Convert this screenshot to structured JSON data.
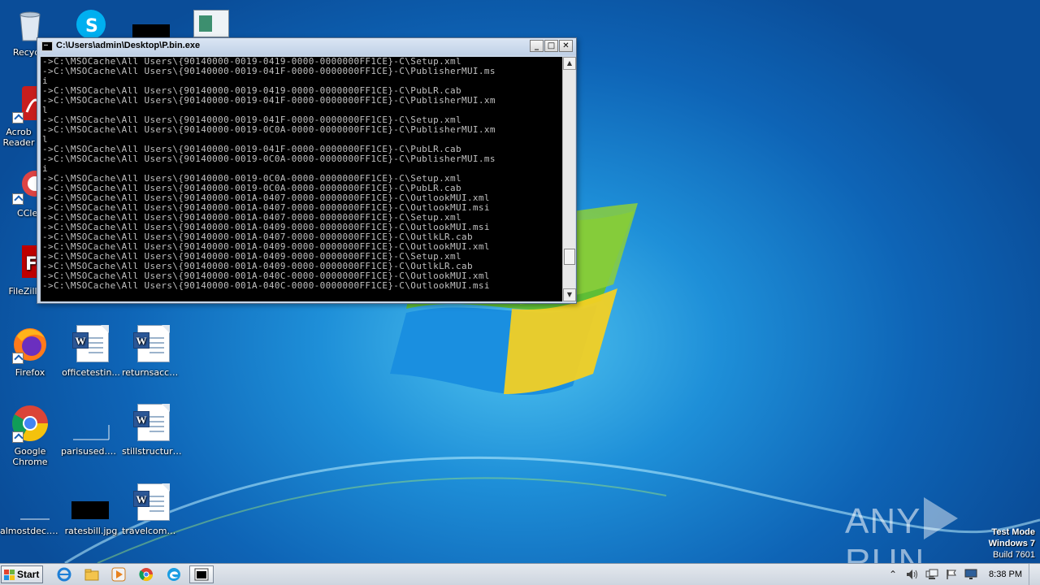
{
  "window": {
    "title": "C:\\Users\\admin\\Desktop\\P.bin.exe",
    "buttons": {
      "minimize": "_",
      "maximize": "□",
      "close": "✕"
    },
    "console_lines": [
      "->C:\\MSOCache\\All Users\\{90140000-0019-0419-0000-0000000FF1CE}-C\\Setup.xml",
      "->C:\\MSOCache\\All Users\\{90140000-0019-041F-0000-0000000FF1CE}-C\\PublisherMUI.ms",
      "i",
      "->C:\\MSOCache\\All Users\\{90140000-0019-0419-0000-0000000FF1CE}-C\\PubLR.cab",
      "->C:\\MSOCache\\All Users\\{90140000-0019-041F-0000-0000000FF1CE}-C\\PublisherMUI.xm",
      "l",
      "->C:\\MSOCache\\All Users\\{90140000-0019-041F-0000-0000000FF1CE}-C\\Setup.xml",
      "->C:\\MSOCache\\All Users\\{90140000-0019-0C0A-0000-0000000FF1CE}-C\\PublisherMUI.xm",
      "l",
      "->C:\\MSOCache\\All Users\\{90140000-0019-041F-0000-0000000FF1CE}-C\\PubLR.cab",
      "->C:\\MSOCache\\All Users\\{90140000-0019-0C0A-0000-0000000FF1CE}-C\\PublisherMUI.ms",
      "i",
      "->C:\\MSOCache\\All Users\\{90140000-0019-0C0A-0000-0000000FF1CE}-C\\Setup.xml",
      "->C:\\MSOCache\\All Users\\{90140000-0019-0C0A-0000-0000000FF1CE}-C\\PubLR.cab",
      "->C:\\MSOCache\\All Users\\{90140000-001A-0407-0000-0000000FF1CE}-C\\OutlookMUI.xml",
      "->C:\\MSOCache\\All Users\\{90140000-001A-0407-0000-0000000FF1CE}-C\\OutlookMUI.msi",
      "->C:\\MSOCache\\All Users\\{90140000-001A-0407-0000-0000000FF1CE}-C\\Setup.xml",
      "->C:\\MSOCache\\All Users\\{90140000-001A-0409-0000-0000000FF1CE}-C\\OutlookMUI.msi",
      "->C:\\MSOCache\\All Users\\{90140000-001A-0407-0000-0000000FF1CE}-C\\OutlkLR.cab",
      "->C:\\MSOCache\\All Users\\{90140000-001A-0409-0000-0000000FF1CE}-C\\OutlookMUI.xml",
      "->C:\\MSOCache\\All Users\\{90140000-001A-0409-0000-0000000FF1CE}-C\\Setup.xml",
      "->C:\\MSOCache\\All Users\\{90140000-001A-0409-0000-0000000FF1CE}-C\\OutlkLR.cab",
      "->C:\\MSOCache\\All Users\\{90140000-001A-040C-0000-0000000FF1CE}-C\\OutlookMUI.xml",
      "->C:\\MSOCache\\All Users\\{90140000-001A-040C-0000-0000000FF1CE}-C\\OutlookMUI.msi"
    ]
  },
  "desktop_icons": {
    "recycle": "Recycle",
    "acrobat": "Acrob Reader",
    "ccleaner": "CClea",
    "filezilla": "FileZilla C",
    "firefox": "Firefox",
    "officetesting": "officetestin...",
    "returnsacco": "returnsacco...",
    "chrome": "Google Chrome",
    "parisused": "parisused.png",
    "stillstructure": "stillstructura...",
    "almostdec": "almostdec.png",
    "ratesbill": "ratesbill.jpg",
    "travelcomm": "travelcomm..."
  },
  "watermark": {
    "left": "ANY",
    "right": "RUN"
  },
  "test_mode": {
    "line1": "Test Mode",
    "line2": "Windows 7",
    "line3": "Build 7601"
  },
  "taskbar": {
    "start_label": "Start",
    "clock": "8:38 PM"
  },
  "colors": {
    "console_bg": "#000000",
    "console_fg": "#c0c0c0",
    "taskbar": "#d6dce4"
  }
}
